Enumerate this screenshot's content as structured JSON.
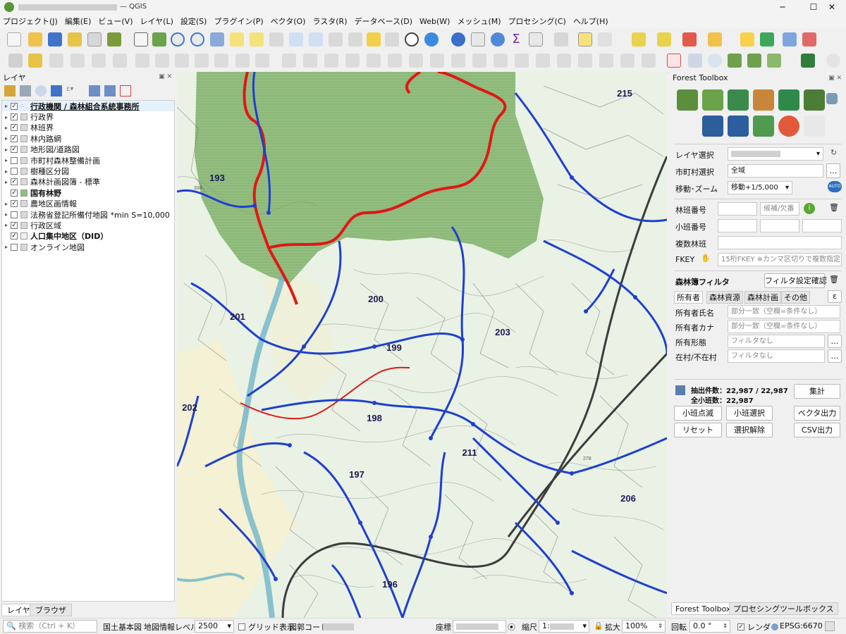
{
  "window": {
    "title": "— QGIS",
    "minimize": "─",
    "maximize": "☐",
    "close": "✕"
  },
  "menu": [
    "プロジェクト(J)",
    "編集(E)",
    "ビュー(V)",
    "レイヤ(L)",
    "設定(S)",
    "プラグイン(P)",
    "ベクタ(O)",
    "ラスタ(R)",
    "データベース(D)",
    "Web(W)",
    "メッシュ(M)",
    "プロセシング(C)",
    "ヘルプ(H)"
  ],
  "layers_panel": {
    "title": "レイヤ",
    "items": [
      {
        "label": "行政機関 / 森林組合系統事務所",
        "checked": true,
        "bold": true,
        "underline": true,
        "expander": "▸"
      },
      {
        "label": "行政界",
        "checked": true,
        "bold": false,
        "expander": "▸"
      },
      {
        "label": "林班界",
        "checked": true,
        "bold": false,
        "expander": "▸"
      },
      {
        "label": "林内路網",
        "checked": true,
        "bold": false,
        "expander": "▸"
      },
      {
        "label": "地形図/道路図",
        "checked": true,
        "bold": false,
        "expander": "▸"
      },
      {
        "label": "市町村森林整備計画",
        "checked": false,
        "bold": false,
        "expander": "▸"
      },
      {
        "label": "樹種区分図",
        "checked": false,
        "bold": false,
        "expander": "▸"
      },
      {
        "label": "森林計画図簿 - 標準",
        "checked": true,
        "bold": false,
        "expander": "▸"
      },
      {
        "label": "国有林野",
        "checked": true,
        "bold": true,
        "expander": ""
      },
      {
        "label": "農地区画情報",
        "checked": true,
        "bold": false,
        "expander": "▸"
      },
      {
        "label": "法務省登記所備付地図 *min S=10,000",
        "checked": false,
        "bold": false,
        "expander": "▸"
      },
      {
        "label": "行政区域",
        "checked": true,
        "bold": false,
        "expander": "▸"
      },
      {
        "label": "人口集中地区（DID）",
        "checked": true,
        "bold": true,
        "expander": ""
      },
      {
        "label": "オンライン地図",
        "checked": false,
        "bold": false,
        "expander": "▸"
      }
    ],
    "tabs": [
      "レイヤ",
      "ブラウザ"
    ]
  },
  "map": {
    "labels": [
      {
        "text": "215"
      },
      {
        "text": "193"
      },
      {
        "text": "200"
      },
      {
        "text": "201"
      },
      {
        "text": "199"
      },
      {
        "text": "203"
      },
      {
        "text": "202"
      },
      {
        "text": "198"
      },
      {
        "text": "211"
      },
      {
        "text": "197"
      },
      {
        "text": "206"
      },
      {
        "text": "196"
      }
    ],
    "small_labels": [
      "334",
      "278"
    ]
  },
  "forest_toolbox": {
    "title": "Forest Toolbox",
    "layer_select_label": "レイヤ選択",
    "city_select_label": "市町村選択",
    "city_value": "全域",
    "move_zoom_label": "移動･ズーム",
    "move_zoom_value": "移動+1/5,000",
    "auto_label": "AUTO",
    "rinpan_label": "林班番号",
    "candidate_placeholder": "候補/欠番",
    "shohan_label": "小班番号",
    "fukusu_label": "複数林班",
    "fkey_label": "FKEY",
    "fkey_placeholder": "15桁FKEY ※カンマ区切りで複数指定",
    "filter_title": "森林簿フィルタ",
    "filter_confirm": "フィルタ設定確認",
    "tabs": [
      "所有者",
      "森林資源",
      "森林計画",
      "その他"
    ],
    "epsilon": "ε",
    "fields": [
      {
        "label": "所有者氏名",
        "placeholder": "部分一致（空欄=条件なし）",
        "has_btn": false
      },
      {
        "label": "所有者カナ",
        "placeholder": "部分一致（空欄=条件なし）",
        "has_btn": false
      },
      {
        "label": "所有形態",
        "placeholder": "フィルタなし",
        "has_btn": true
      },
      {
        "label": "在村/不在村",
        "placeholder": "フィルタなし",
        "has_btn": true
      }
    ],
    "extract_count": "抽出件数：22,987 / 22,987",
    "total_count": "全小班数：22,987",
    "btn_sum": "集計",
    "btn_blink": "小班点滅",
    "btn_select": "小班選択",
    "btn_vector": "ベクタ出力",
    "btn_reset": "リセット",
    "btn_deselect": "選択解除",
    "btn_csv": "CSV出力",
    "bottom_tabs": [
      "Forest Toolbox",
      "プロセシングツールボックス"
    ]
  },
  "status": {
    "search_placeholder": "検索（Ctrl + K）",
    "kokudo": "国土基本図",
    "level_label": "地図情報レベル",
    "level_value": "2500",
    "grid_label": "グリッド表示",
    "zukaku_label": "図郭コード:",
    "coord_label": "座標",
    "scale_label": "縮尺",
    "scale_prefix": "1:",
    "zoom_label": "拡大",
    "zoom_value": "100%",
    "rotation_label": "回転",
    "rotation_value": "0.0 °",
    "render_label": "レンダ",
    "crs": "EPSG:6670"
  },
  "colors": {
    "forest": "#93be80",
    "road_blue": "#1f3fd0",
    "boundary_red": "#e11717",
    "river": "#6fb5c8",
    "rail": "#3c3c3c"
  }
}
